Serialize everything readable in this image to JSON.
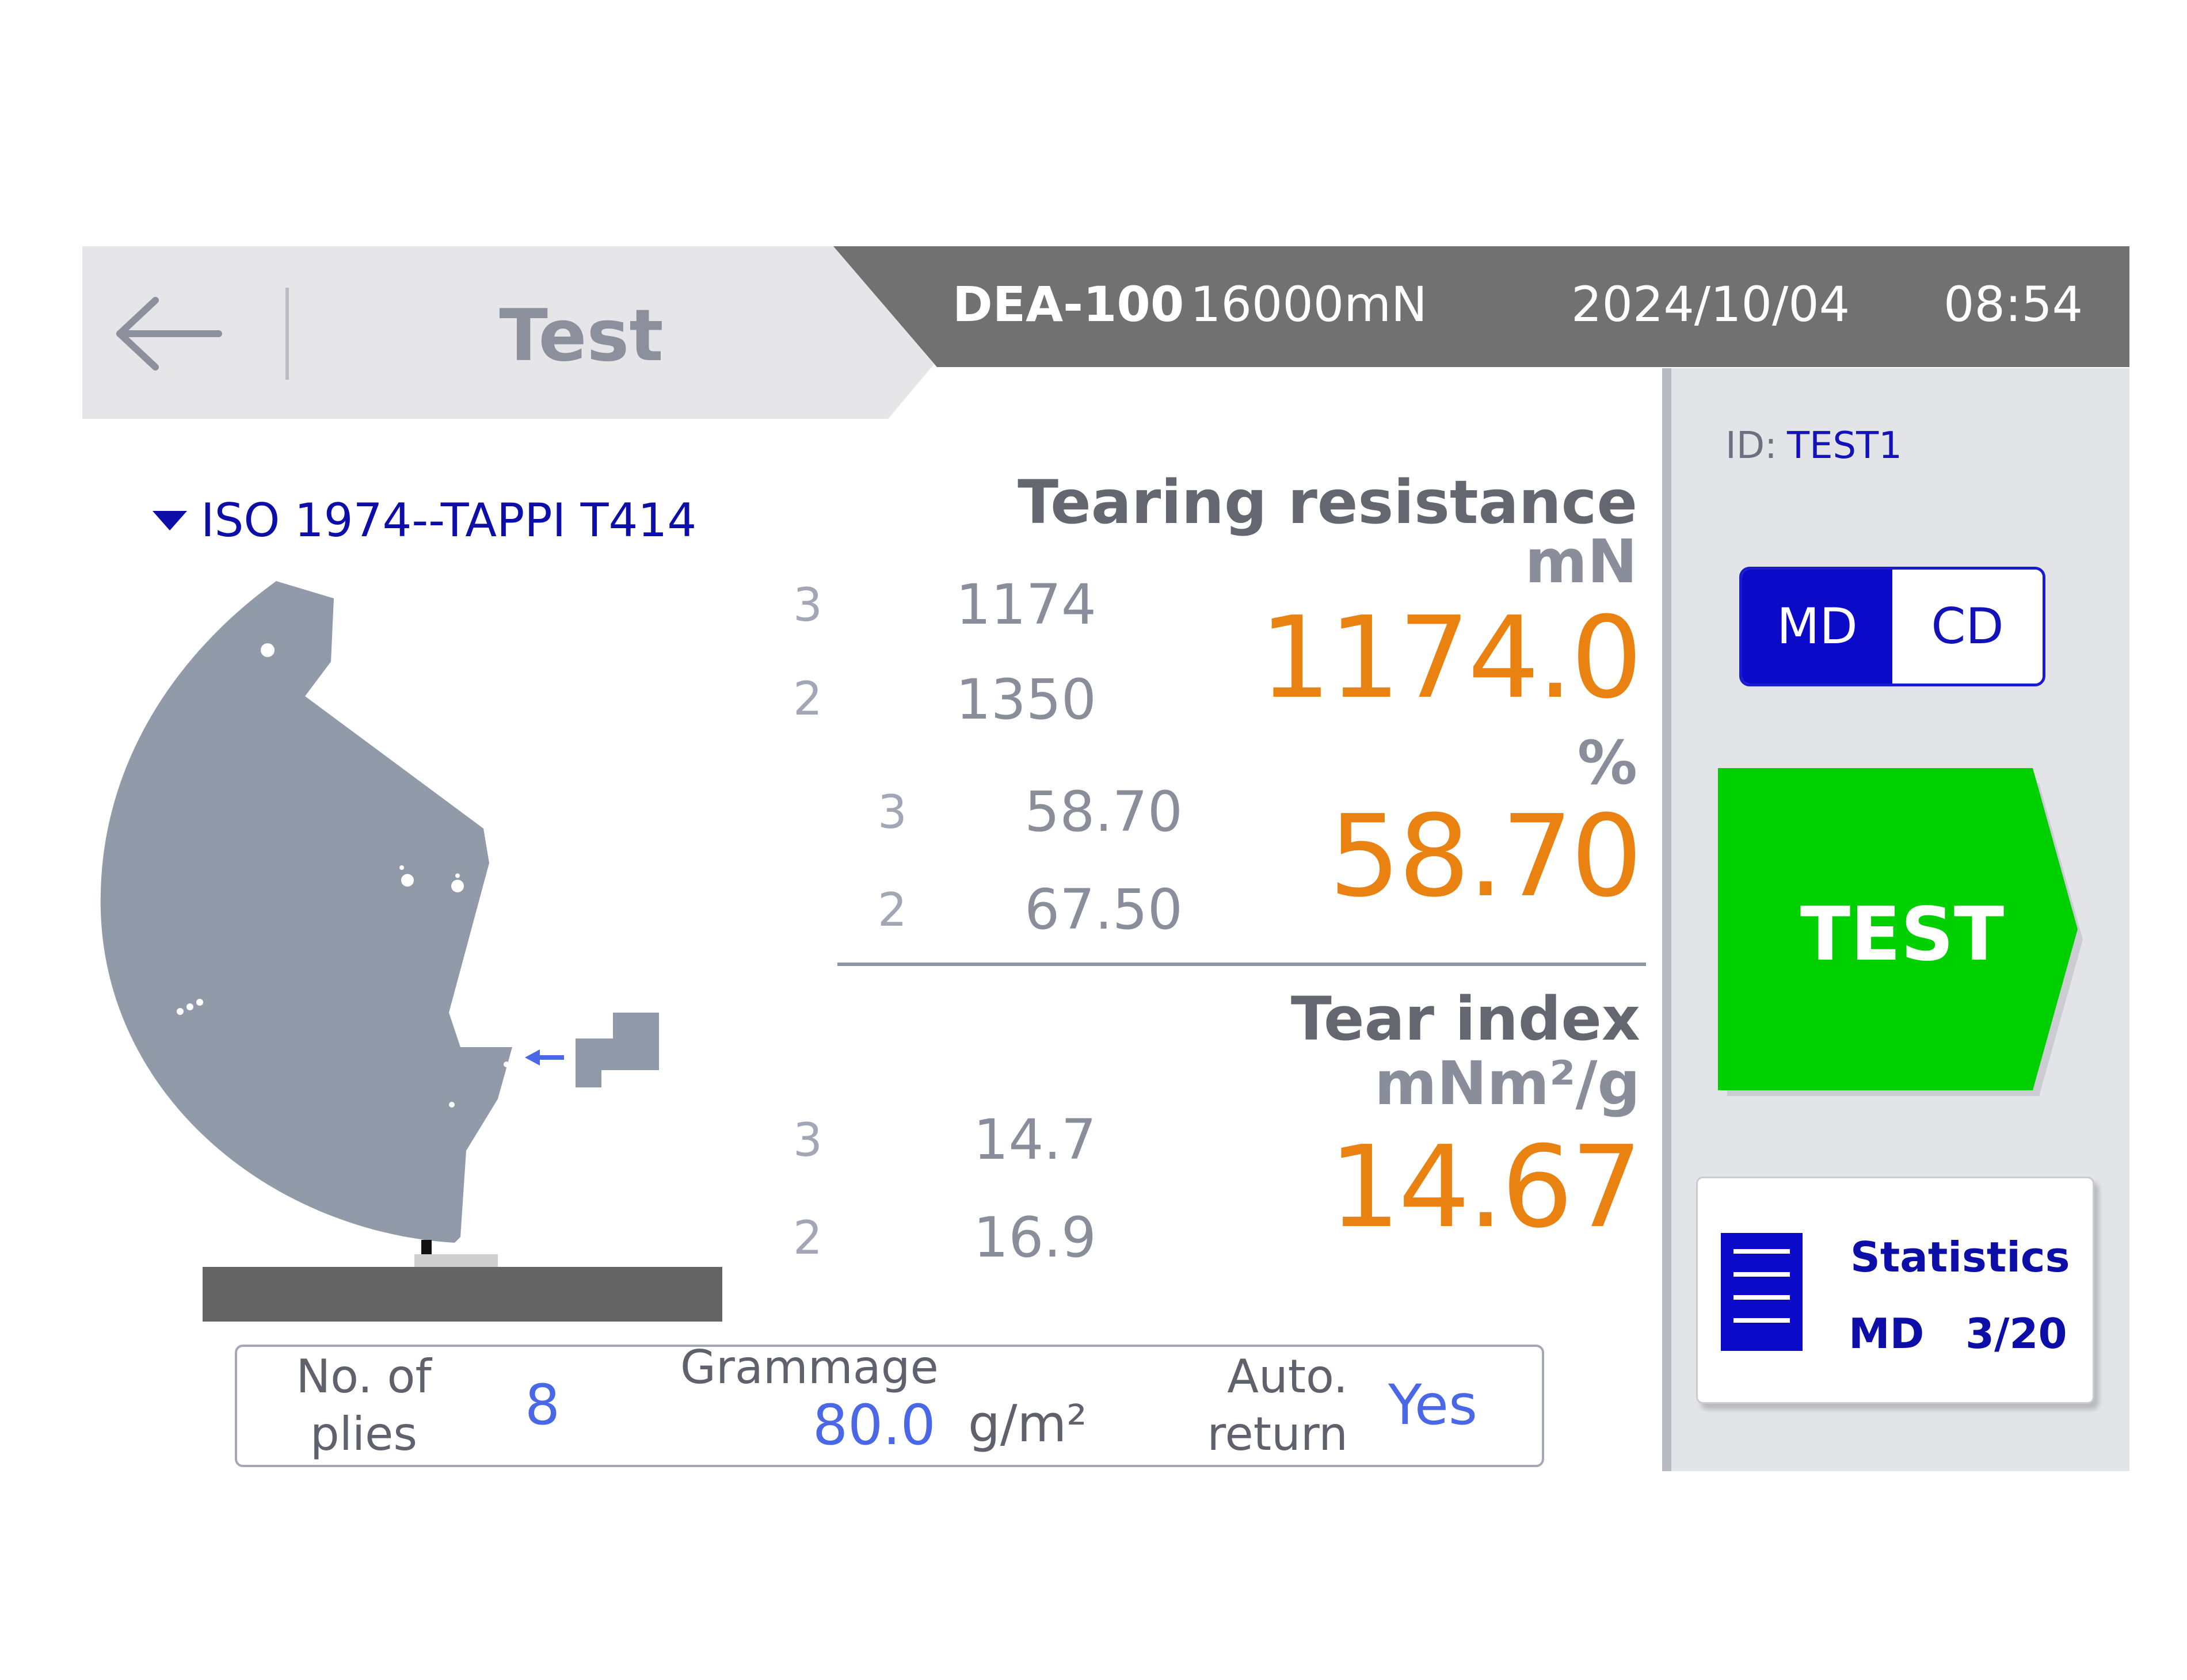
{
  "header": {
    "title": "Test",
    "device_model": "DEA-100",
    "device_load": "16000mN",
    "date": "2024/10/04",
    "time": "08:54"
  },
  "colors": {
    "header_gray": "#717171",
    "header_light": "#e6e6e8",
    "accent_blue": "#0a0ac8",
    "result_orange": "#ea8212",
    "test_green": "#00d000"
  },
  "standard": {
    "label": "ISO 1974--TAPPI T414"
  },
  "tearing_resistance": {
    "title": "Tearing resistance",
    "unit": "mN",
    "value": "1174.0",
    "history": [
      {
        "index": "3",
        "value": "1174"
      },
      {
        "index": "2",
        "value": "1350"
      }
    ]
  },
  "percent": {
    "unit": "%",
    "value": "58.70",
    "history": [
      {
        "index": "3",
        "value": "58.70"
      },
      {
        "index": "2",
        "value": "67.50"
      }
    ]
  },
  "tear_index": {
    "title": "Tear index",
    "unit": "mNm²/g",
    "value": "14.67",
    "history": [
      {
        "index": "3",
        "value": "14.7"
      },
      {
        "index": "2",
        "value": "16.9"
      }
    ]
  },
  "params": {
    "plies_label_1": "No. of",
    "plies_label_2": "plies",
    "plies_value": "8",
    "grammage_label": "Grammage",
    "grammage_value": "80.0",
    "grammage_unit": "g/m²",
    "autoreturn_label_1": "Auto.",
    "autoreturn_label_2": "return",
    "autoreturn_value": "Yes"
  },
  "sidebar": {
    "id_label": "ID:",
    "id_value": "TEST1",
    "md_label": "MD",
    "cd_label": "CD",
    "selected_direction": "MD",
    "test_label": "TEST",
    "statistics_title": "Statistics",
    "statistics_mode": "MD",
    "statistics_count": "3/20"
  },
  "icons": {
    "back": "back-arrow-icon",
    "dropdown": "dropdown-triangle-icon",
    "statistics": "list-icon"
  }
}
